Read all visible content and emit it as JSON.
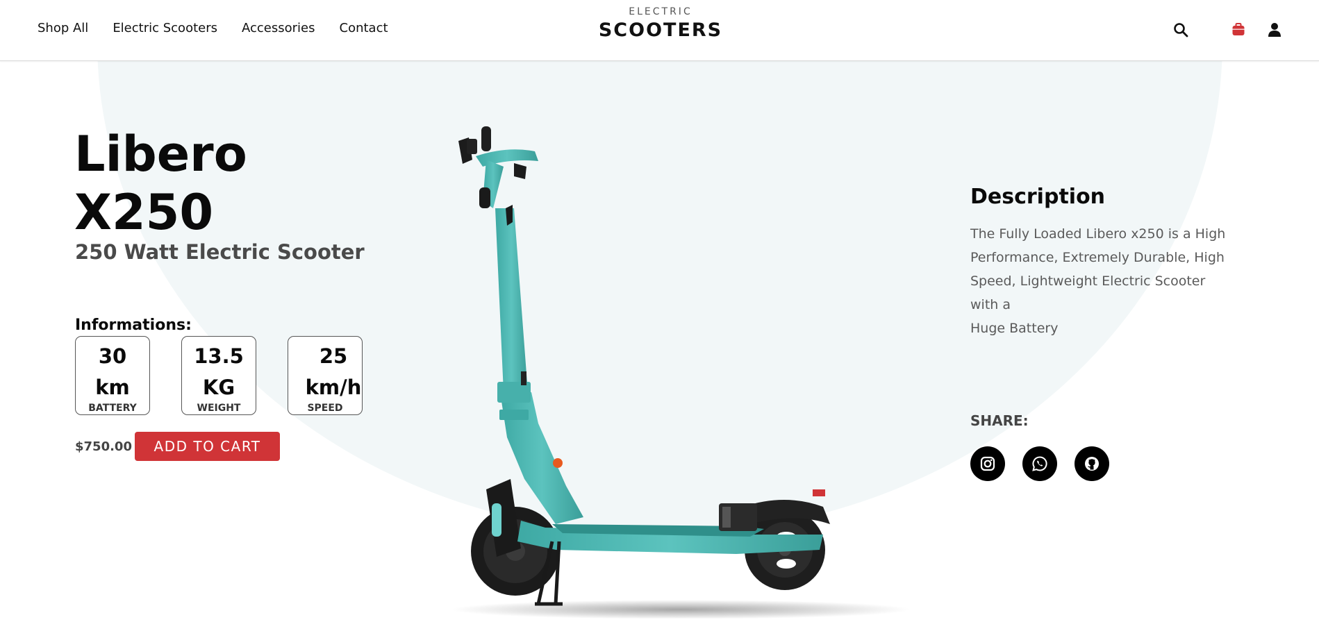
{
  "nav": {
    "items": [
      {
        "label": "Shop All"
      },
      {
        "label": "Electric Scooters"
      },
      {
        "label": "Accessories"
      },
      {
        "label": "Contact"
      }
    ]
  },
  "logo": {
    "top": "ELECTRIC",
    "main": "SCOOTERS"
  },
  "header_icons": {
    "search": "search-icon",
    "cart": "cart-icon",
    "user": "user-icon"
  },
  "product": {
    "title_line1": "Libero",
    "title_line2": "X250",
    "subtitle": "250 Watt Electric Scooter",
    "info_label": "Informations:",
    "specs": [
      {
        "value_line1": "30",
        "value_line2": "km",
        "label": "BATTERY"
      },
      {
        "value_line1": "13.5",
        "value_line2": "KG",
        "label": "WEIGHT"
      },
      {
        "value_line1": "25",
        "value_line2": "km/h",
        "label": "SPEED"
      }
    ],
    "price": "$750.00",
    "add_to_cart": "ADD TO CART"
  },
  "description": {
    "title": "Description",
    "lines": [
      "The Fully Loaded Libero x250 is a High",
      "Performance, Extremely Durable, High",
      "Speed, Lightweight Electric Scooter",
      "with a",
      "Huge Battery"
    ]
  },
  "share": {
    "label": "SHARE:",
    "icons": [
      "instagram-icon",
      "whatsapp-icon",
      "github-icon"
    ]
  },
  "colors": {
    "accent": "#d03437",
    "scooter": "#4fb8b4",
    "background_circle": "#f2f7f8"
  }
}
